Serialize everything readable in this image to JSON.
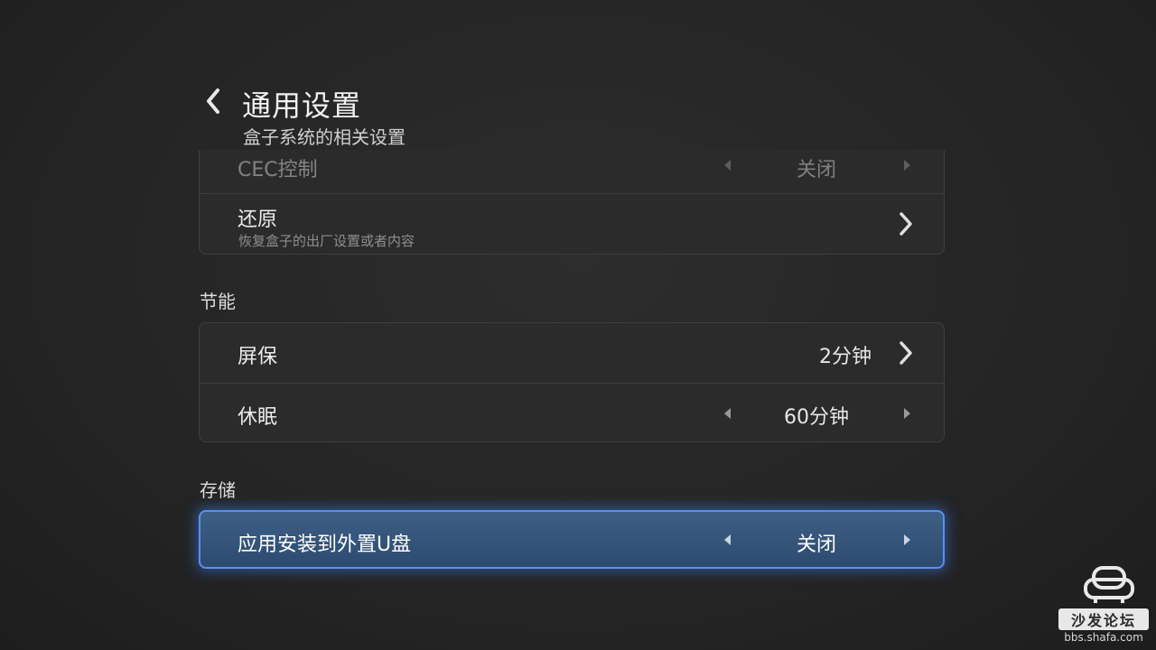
{
  "header": {
    "title": "通用设置",
    "subtitle": "盒子系统的相关设置"
  },
  "general": {
    "cec": {
      "label": "CEC控制",
      "value": "关闭"
    },
    "restore": {
      "label": "还原",
      "description": "恢复盒子的出厂设置或者内容"
    }
  },
  "energy": {
    "section_title": "节能",
    "screensaver": {
      "label": "屏保",
      "value": "2分钟"
    },
    "sleep": {
      "label": "休眠",
      "value": "60分钟"
    }
  },
  "storage": {
    "section_title": "存储",
    "install_to_usb": {
      "label": "应用安装到外置U盘",
      "value": "关闭"
    }
  },
  "watermark": {
    "name": "沙发论坛",
    "url": "bbs.shafa.com"
  },
  "colors": {
    "focus_border": "#5b8ff0",
    "focus_fill": "#3d5f86",
    "background": "#262626"
  }
}
